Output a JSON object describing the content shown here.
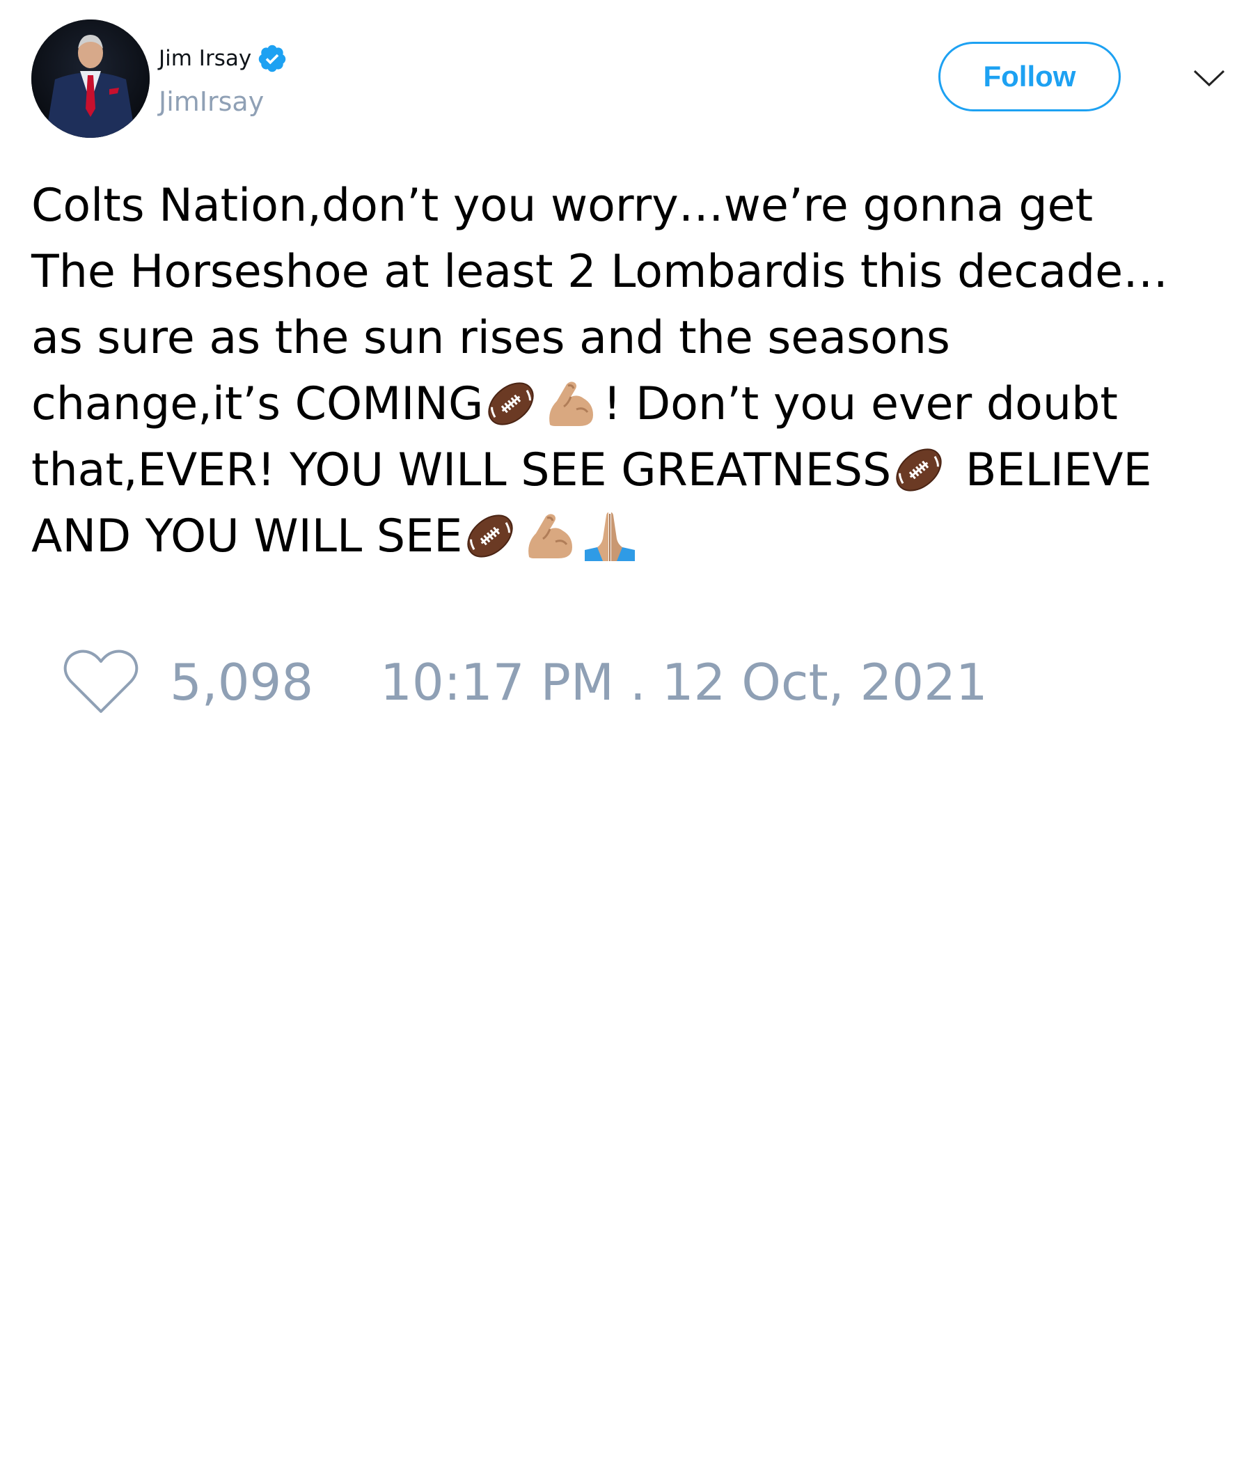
{
  "user": {
    "display_name": "Jim Irsay",
    "handle": "JimIrsay",
    "verified": true
  },
  "actions": {
    "follow_label": "Follow",
    "menu_icon": "chevron-down-icon"
  },
  "tweet": {
    "lines": [
      "Colts Nation,don’t you worry…we’re gonna get",
      "The Horseshoe at least 2 Lombardis this decade…",
      "as sure as the sun rises and the seasons"
    ],
    "line4": {
      "before": "change,it’s COMING",
      "emojis": [
        "american-football-emoji",
        "flexed-biceps-emoji"
      ],
      "after": "! Don’t you ever doubt"
    },
    "line5": {
      "before": "that,EVER! YOU WILL SEE GREATNESS",
      "emojis": [
        "american-football-emoji"
      ],
      "after": " BELIEVE"
    },
    "line6": {
      "before": "AND YOU WILL SEE",
      "emojis": [
        "american-football-emoji",
        "flexed-biceps-emoji",
        "folded-hands-emoji"
      ]
    }
  },
  "footer": {
    "like_count": "5,098",
    "timestamp": "10:17 PM . 12 Oct, 2021",
    "like_icon": "heart-icon"
  },
  "colors": {
    "accent": "#1da1f2",
    "muted_text": "#8fa0b5",
    "text": "#000000"
  }
}
